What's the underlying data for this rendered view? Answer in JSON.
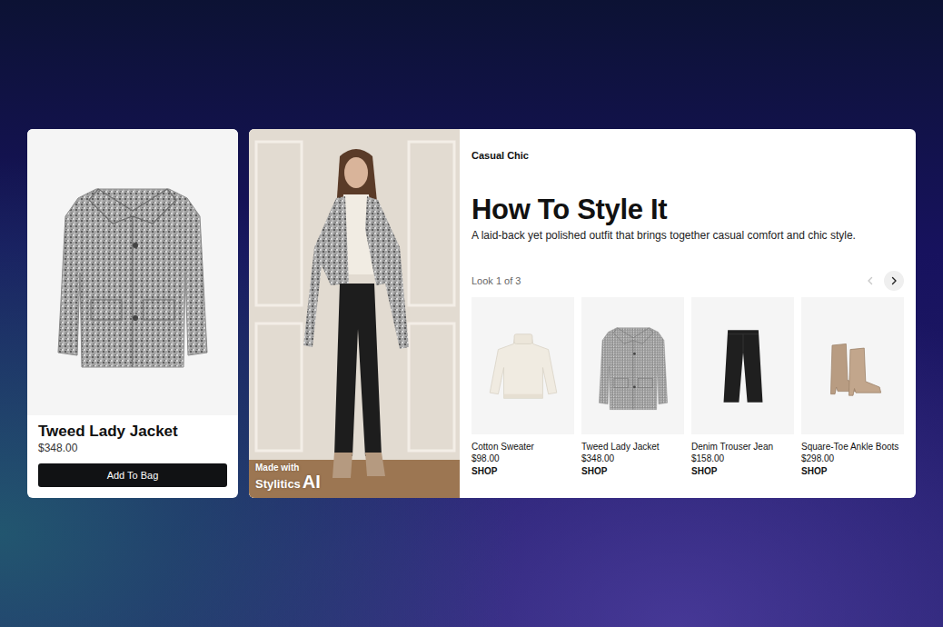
{
  "product": {
    "name": "Tweed Lady Jacket",
    "price": "$348.00",
    "button": "Add To Bag"
  },
  "look": {
    "badge": {
      "prefix": "Made with",
      "brand": "Stylitics",
      "suffix": "AI"
    },
    "category": "Casual Chic",
    "title": "How To Style It",
    "description": "A laid-back yet polished outfit that brings together casual comfort and chic style.",
    "counter": "Look 1 of 3",
    "prev": {
      "disabled": true
    },
    "next": {
      "disabled": false
    },
    "items": [
      {
        "kind": "sweater",
        "name": "Cotton Sweater",
        "price": "$98.00",
        "cta": "SHOP"
      },
      {
        "kind": "jacket",
        "name": "Tweed Lady Jacket",
        "price": "$348.00",
        "cta": "SHOP"
      },
      {
        "kind": "jeans",
        "name": "Denim Trouser Jean",
        "price": "$158.00",
        "cta": "SHOP"
      },
      {
        "kind": "boots",
        "name": "Square-Toe Ankle Boots",
        "price": "$298.00",
        "cta": "SHOP"
      }
    ]
  }
}
